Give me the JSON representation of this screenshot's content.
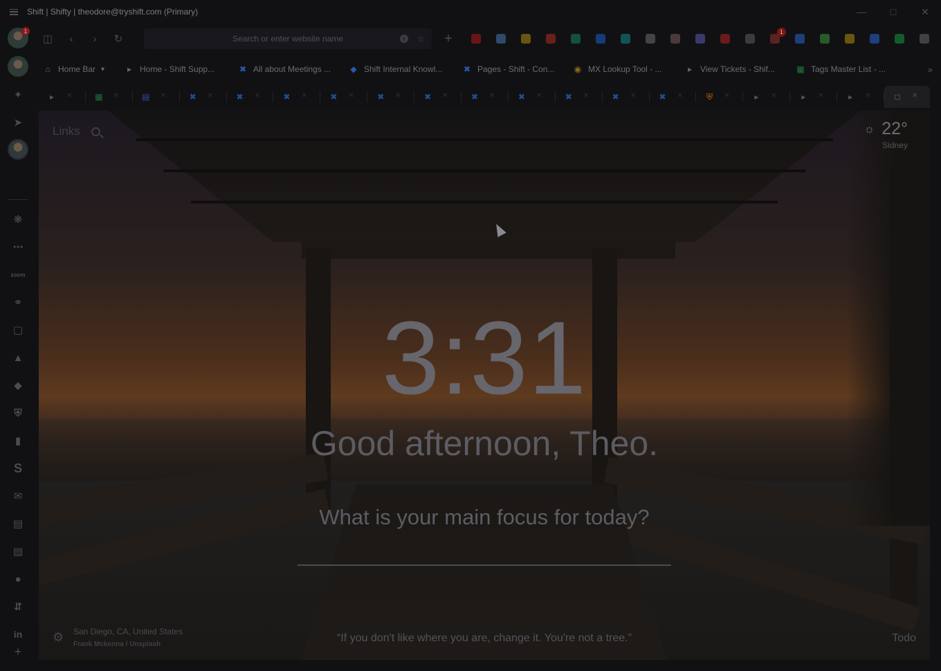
{
  "window": {
    "title": "Shift | Shifty | theodore@tryshift.com (Primary)",
    "controls": [
      "minimize-icon",
      "maximize-icon",
      "close-icon"
    ]
  },
  "dock": {
    "top_badge": "1",
    "bottom_add": "+"
  },
  "navbar": {
    "search_placeholder": "Search or enter website name",
    "new_tab_symbol": "+",
    "extensions": [
      {
        "icon": "red-app-icon",
        "color": "#6b1414"
      },
      {
        "icon": "multi-color-app-icon",
        "color": "#2f4a6a"
      },
      {
        "icon": "yellow-app-icon",
        "color": "#6a5510"
      },
      {
        "icon": "todoist-icon",
        "color": "#6b1f18"
      },
      {
        "icon": "grammarly-icon",
        "color": "#15503a"
      },
      {
        "icon": "zoom-icon",
        "color": "#173a7a"
      },
      {
        "icon": "teal-app-icon",
        "color": "#125454"
      },
      {
        "icon": "cloud-icon",
        "color": "#444448"
      },
      {
        "icon": "jar-icon",
        "color": "#4a3a3a"
      },
      {
        "icon": "chrome-icon",
        "color": "#3a3a6a"
      },
      {
        "icon": "calendar-red-icon",
        "color": "#6a1a1a"
      },
      {
        "icon": "layers-icon",
        "color": "#3a3a40"
      },
      {
        "icon": "gmail-icon",
        "color": "#5a2222",
        "badge": "1"
      },
      {
        "icon": "google-calendar-icon",
        "color": "#1f3f7a"
      },
      {
        "icon": "google-drive-icon",
        "color": "#2a5a2a"
      },
      {
        "icon": "google-keep-icon",
        "color": "#6a5510"
      },
      {
        "icon": "google-docs-icon",
        "color": "#1f3f7a"
      },
      {
        "icon": "google-sheets-icon",
        "color": "#155a2a"
      },
      {
        "icon": "settings-gear-icon",
        "color": "#404046"
      }
    ]
  },
  "bookmarks": {
    "items": [
      {
        "label": "Home Bar",
        "icon": "home-icon",
        "dropdown": true
      },
      {
        "label": "Home - Shift Supp...",
        "icon": "zendesk-icon"
      },
      {
        "label": "All about Meetings ...",
        "icon": "confluence-icon"
      },
      {
        "label": "Shift Internal Knowl...",
        "icon": "diamond-icon"
      },
      {
        "label": "Pages - Shift - Con...",
        "icon": "confluence-icon"
      },
      {
        "label": "MX Lookup Tool - ...",
        "icon": "mxtoolbox-icon"
      },
      {
        "label": "View Tickets - Shif...",
        "icon": "zendesk-icon"
      },
      {
        "label": "Tags Master List - ...",
        "icon": "google-sheets-icon"
      }
    ],
    "more": "»"
  },
  "tabs": [
    {
      "icon": "zendesk-icon",
      "color": "#555"
    },
    {
      "icon": "google-sheets-icon",
      "color": "#1d6b3a"
    },
    {
      "icon": "google-docs-icon",
      "color": "#2a4f9a"
    },
    {
      "icon": "confluence-icon",
      "color": "#1f4f9a"
    },
    {
      "icon": "confluence-icon",
      "color": "#1f4f9a"
    },
    {
      "icon": "confluence-icon",
      "color": "#1f4f9a"
    },
    {
      "icon": "confluence-icon",
      "color": "#1f4f9a"
    },
    {
      "icon": "confluence-icon",
      "color": "#1f4f9a"
    },
    {
      "icon": "confluence-icon",
      "color": "#1f4f9a"
    },
    {
      "icon": "confluence-icon",
      "color": "#1f4f9a"
    },
    {
      "icon": "confluence-icon",
      "color": "#1f4f9a"
    },
    {
      "icon": "confluence-icon",
      "color": "#1f4f9a"
    },
    {
      "icon": "confluence-icon",
      "color": "#1f4f9a"
    },
    {
      "icon": "confluence-icon",
      "color": "#1f4f9a"
    },
    {
      "icon": "shield-book-icon",
      "color": "#8a4a10"
    },
    {
      "icon": "zendesk-icon",
      "color": "#555"
    },
    {
      "icon": "zendesk-icon",
      "color": "#555"
    },
    {
      "icon": "zendesk-icon",
      "color": "#555"
    },
    {
      "icon": "page-icon",
      "color": "#777",
      "active": true
    }
  ],
  "momentum": {
    "links_label": "Links",
    "weather": {
      "temp": "22°",
      "city": "Sidney"
    },
    "clock": "3:31",
    "greeting": "Good afternoon, Theo.",
    "focus_question": "What is your main focus for today?",
    "focus_value": "",
    "location": "San Diego, CA, United States",
    "photo_credit": "Frank Mckenna / Unsplash",
    "quote": "“If you don't like where you are, change it. You're not a tree.”",
    "todo_label": "Todo"
  }
}
